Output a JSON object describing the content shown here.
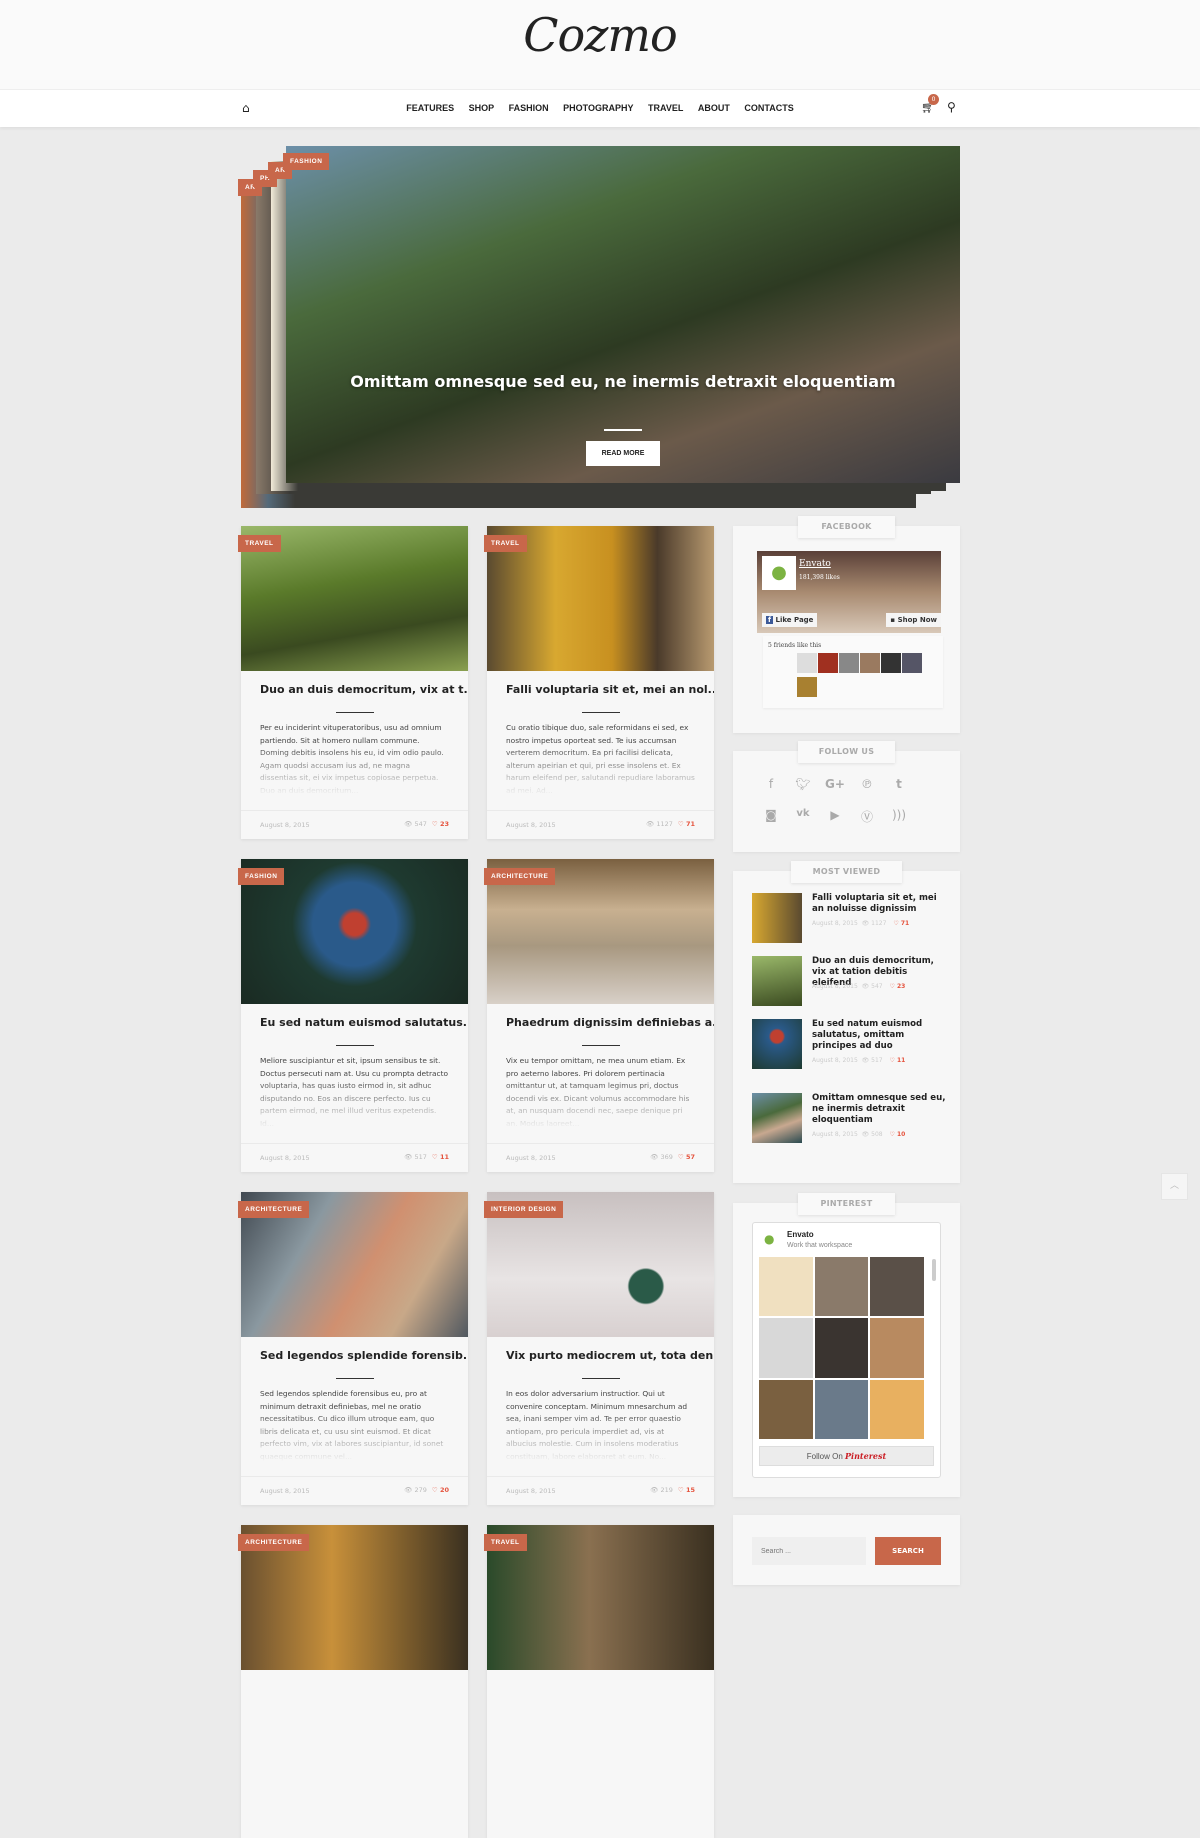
{
  "logo": "Cozmo",
  "nav": {
    "items": [
      "FEATURES",
      "SHOP",
      "FASHION",
      "PHOTOGRAPHY",
      "TRAVEL",
      "ABOUT",
      "CONTACTS"
    ],
    "cart_count": "0"
  },
  "hero": {
    "categories": [
      "AR",
      "PH",
      "AR",
      "FASHION"
    ],
    "title": "Omittam omnesque sed eu, ne inermis detraxit eloquentiam",
    "button": "READ MORE"
  },
  "accent": "#c8674a",
  "posts": [
    {
      "category": "TRAVEL",
      "title": "Duo an duis democritum, vix at t...",
      "excerpt": "Per eu inciderint vituperatoribus, usu ad omnium partiendo. Sit at homero nullam commune. Doming debitis insolens his eu, id vim odio paulo. Agam quodsi accusam ius ad, ne magna dissentias sit, ei vix impetus copiosae perpetua. Duo an duis democritum...",
      "date": "August 8, 2015",
      "views": "547",
      "likes": "23"
    },
    {
      "category": "TRAVEL",
      "title": "Falli voluptaria sit et, mei an nol...",
      "excerpt": "Cu oratio tibique duo, sale reformidans ei sed, ex nostro impetus oporteat sed. Te ius accumsan verterem democritum. Ea pri facilisi delicata, alterum apeirian et qui, pri esse insolens et. Ex harum eleifend per, salutandi repudiare laboramus ad mei. Ad...",
      "date": "August 8, 2015",
      "views": "1127",
      "likes": "71"
    },
    {
      "category": "FASHION",
      "title": "Eu sed natum euismod salutatus...",
      "excerpt": "Meliore suscipiantur et sit, ipsum sensibus te sit. Doctus persecuti nam at. Usu cu prompta detracto voluptaria, has quas iusto eirmod in, sit adhuc disputando no. Eos an discere perfecto. Ius cu partem eirmod, ne mel illud veritus expetendis. Id...",
      "date": "August 8, 2015",
      "views": "517",
      "likes": "11"
    },
    {
      "category": "ARCHITECTURE",
      "title": "Phaedrum dignissim definiebas a...",
      "excerpt": "Vix eu tempor omittam, ne mea unum etiam. Ex pro aeterno labores. Pri dolorem pertinacia omittantur ut, at tamquam legimus pri, doctus docendi vis ex. Dicant volumus accommodare his at, an nusquam docendi nec, saepe denique pri an. Modus laoreet...",
      "date": "August 8, 2015",
      "views": "369",
      "likes": "57"
    },
    {
      "category": "ARCHITECTURE",
      "title": "Sed legendos splendide forensib...",
      "excerpt": "Sed legendos splendide forensibus eu, pro at minimum detraxit definiebas, mel ne oratio necessitatibus. Cu dico illum utroque eam, quo libris delicata et, cu usu sint euismod. Et dicat perfecto vim, vix at labores suscipiantur, id sonet quaeque commune vel...",
      "date": "August 8, 2015",
      "views": "279",
      "likes": "20"
    },
    {
      "category": "INTERIOR DESIGN",
      "title": "Vix purto mediocrem ut, tota den..",
      "excerpt": "In eos dolor adversarium instructior. Qui ut convenire conceptam. Minimum mnesarchum ad sea, inani semper vim ad. Te per error quaestio antiopam, pro pericula imperdiet ad, vis at albucius molestie. Cum in insolens moderatius constituam, labore elaboraret at eum. No...",
      "date": "August 8, 2015",
      "views": "219",
      "likes": "15"
    },
    {
      "category": "ARCHITECTURE"
    },
    {
      "category": "TRAVEL"
    }
  ],
  "sidebar": {
    "facebook": {
      "title": "FACEBOOK",
      "page": "Envato",
      "likes": "181,398 likes",
      "like_btn": "Like Page",
      "shop_btn": "Shop Now",
      "friends": "5 friends like this"
    },
    "follow": {
      "title": "FOLLOW US",
      "icons": [
        "facebook-icon",
        "twitter-icon",
        "google-plus-icon",
        "pinterest-icon",
        "tumblr-icon",
        "instagram-icon",
        "vk-icon",
        "youtube-icon",
        "vimeo-icon",
        "rss-icon"
      ]
    },
    "most_viewed": {
      "title": "MOST VIEWED",
      "items": [
        {
          "title": "Falli voluptaria sit et, mei an noluisse dignissim",
          "date": "August 8, 2015",
          "views": "1127",
          "likes": "71"
        },
        {
          "title": "Duo an duis democritum, vix at tation debitis eleifend",
          "date": "August 8, 2015",
          "views": "547",
          "likes": "23"
        },
        {
          "title": "Eu sed natum euismod salutatus, omittam principes ad duo",
          "date": "August 8, 2015",
          "views": "517",
          "likes": "11"
        },
        {
          "title": "Omittam omnesque sed eu, ne inermis detraxit eloquentiam",
          "date": "August 8, 2015",
          "views": "508",
          "likes": "10"
        }
      ]
    },
    "pinterest": {
      "title": "PINTEREST",
      "name": "Envato",
      "subtitle": "Work that workspace",
      "follow": "Follow On",
      "brand": "Pinterest"
    },
    "search": {
      "placeholder": "Search ...",
      "button": "SEARCH"
    }
  }
}
